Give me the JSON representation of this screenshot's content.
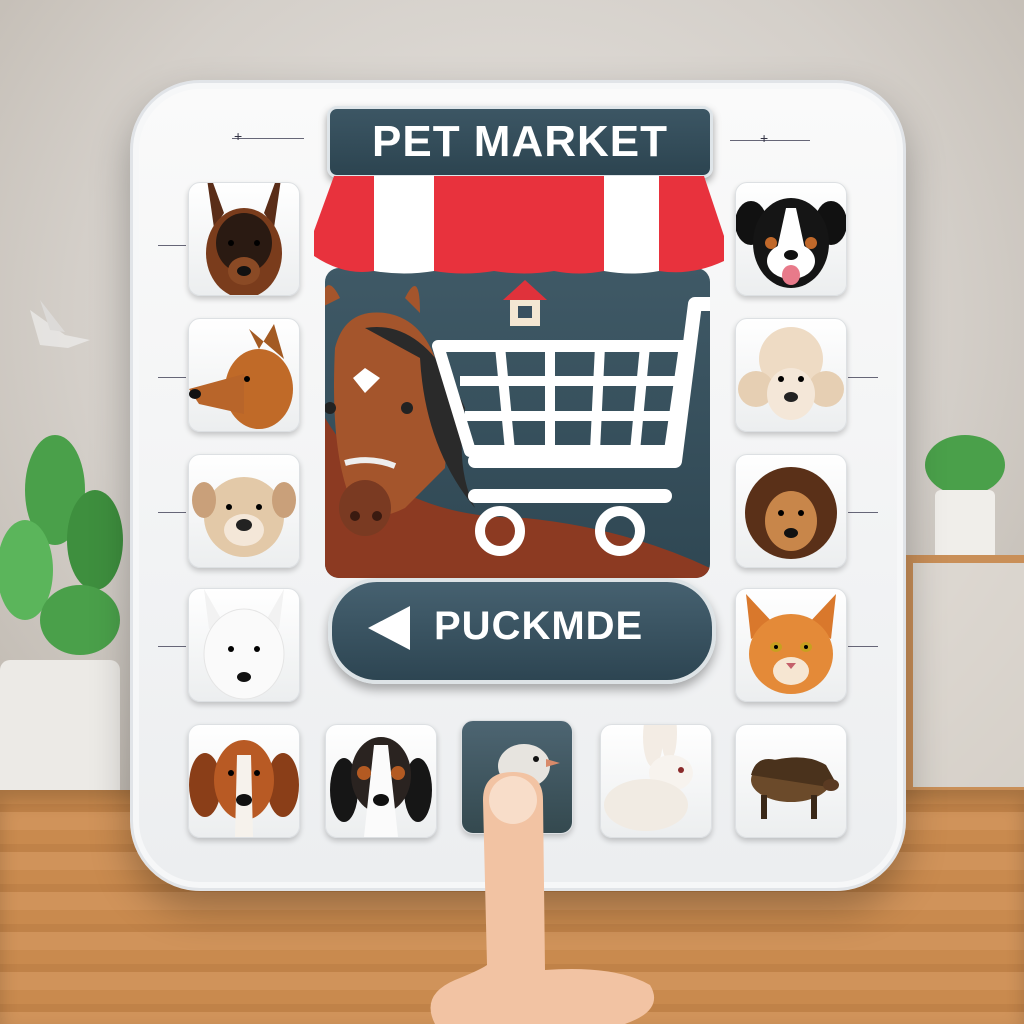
{
  "app": {
    "title": "PET MARKET",
    "action_button": {
      "label": "PUCKMDE",
      "icon": "play-left-triangle-icon"
    }
  },
  "store_icon": "shopping-cart-icon",
  "colors": {
    "panel": "#f2f3f5",
    "plate": "#34505c",
    "awning_red": "#e8323d",
    "awning_white": "#ffffff"
  },
  "tiles": [
    {
      "name": "german-shepherd-dog"
    },
    {
      "name": "bernese-dog"
    },
    {
      "name": "brown-dog"
    },
    {
      "name": "poodle-dog"
    },
    {
      "name": "bulldog"
    },
    {
      "name": "lion-dog"
    },
    {
      "name": "white-dog"
    },
    {
      "name": "orange-cat"
    },
    {
      "name": "hound-dog"
    },
    {
      "name": "beagle-dog"
    },
    {
      "name": "bird"
    },
    {
      "name": "rabbit"
    },
    {
      "name": "boar"
    }
  ]
}
